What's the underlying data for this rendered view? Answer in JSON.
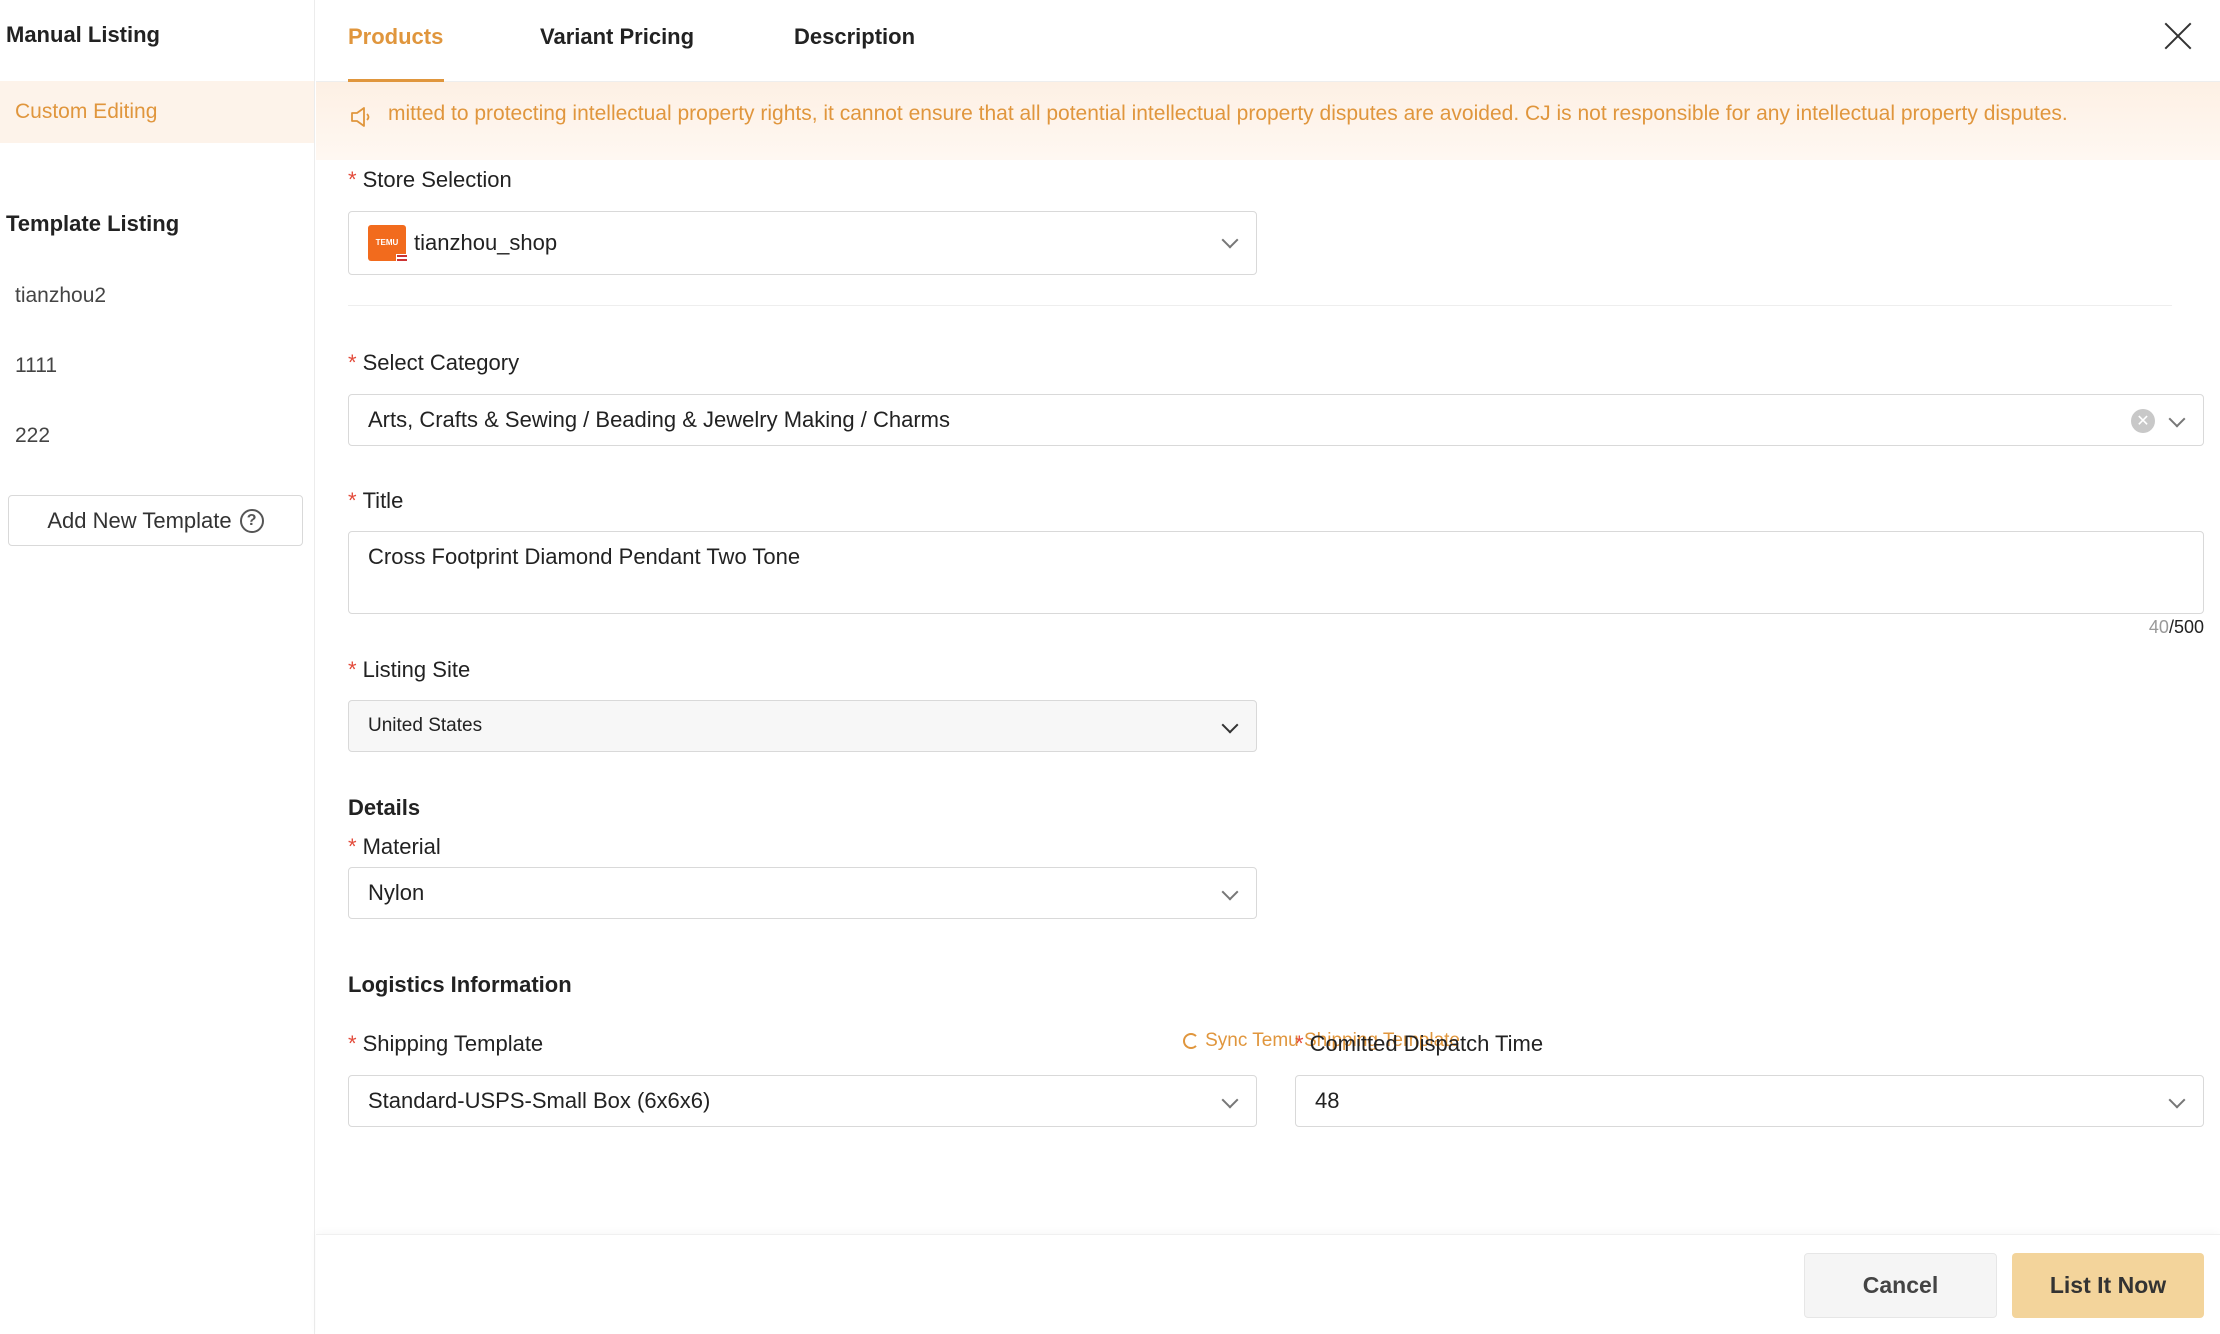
{
  "sidebar": {
    "manual_heading": "Manual Listing",
    "manual_items": [
      {
        "label": "Custom Editing",
        "active": true
      }
    ],
    "template_heading": "Template Listing",
    "template_items": [
      {
        "label": "tianzhou2"
      },
      {
        "label": "1111"
      },
      {
        "label": "222"
      }
    ],
    "add_template_label": "Add New Template",
    "help_glyph": "?"
  },
  "tabs": [
    {
      "label": "Products",
      "active": true
    },
    {
      "label": "Variant Pricing",
      "active": false
    },
    {
      "label": "Description",
      "active": false
    }
  ],
  "banner": {
    "text": "mitted to protecting intellectual property rights, it cannot ensure that all potential intellectual property disputes are avoided. CJ is not responsible for any intellectual property disputes.",
    "icon": "speaker-icon"
  },
  "form": {
    "required_mark": "*",
    "store": {
      "label": "Store Selection",
      "value": "tianzhou_shop",
      "logo_text": "TEMU"
    },
    "category": {
      "label": "Select Category",
      "value": "Arts, Crafts & Sewing / Beading & Jewelry Making / Charms"
    },
    "title": {
      "label": "Title",
      "value": "Cross Footprint Diamond Pendant Two Tone",
      "count": "40",
      "max": "/500"
    },
    "site": {
      "label": "Listing Site",
      "value": "United States"
    },
    "details_heading": "Details",
    "material": {
      "label": "Material",
      "value": "Nylon"
    },
    "logistics_heading": "Logistics Information",
    "shipping": {
      "label": "Shipping Template",
      "value": "Standard-USPS-Small Box (6x6x6)",
      "sync_label": "Sync Temu Shipping Template"
    },
    "dispatch": {
      "label": "Comitted Dispatch Time",
      "value": "48"
    }
  },
  "footer": {
    "cancel_label": "Cancel",
    "list_label": "List It Now"
  },
  "colors": {
    "accent": "#e0963d",
    "required": "#e34b3b",
    "primary_button": "#f3d49b"
  }
}
